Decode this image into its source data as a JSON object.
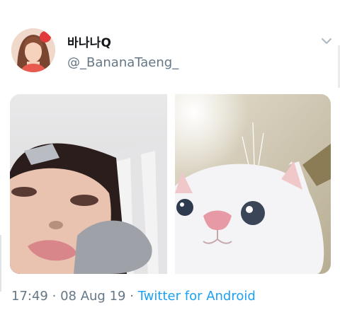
{
  "tweet": {
    "display_name": "바나나Q",
    "handle": "@_BananaTaeng_",
    "menu_icon": "chevron-down-icon",
    "avatar_icon": "profile-photo",
    "media": [
      {
        "description_icon": "selfie-photo"
      },
      {
        "description_icon": "white-cat-photo"
      }
    ],
    "time": "17:49",
    "separator": "·",
    "date": "08 Aug 19",
    "source": "Twitter for Android"
  },
  "colors": {
    "name": "#14171a",
    "secondary": "#657786",
    "link": "#1da1f2"
  }
}
